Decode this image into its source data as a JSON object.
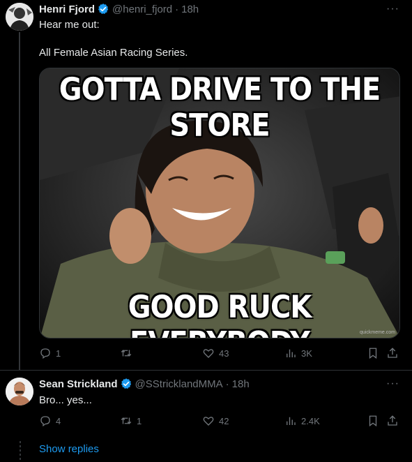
{
  "tweet1": {
    "name": "Henri Fjord",
    "handle": "@henri_fjord",
    "time": "18h",
    "more": "···",
    "text_line1": "Hear me out:",
    "text_line2": "All Female Asian Racing Series.",
    "media": {
      "top_text": "GOTTA DRIVE TO THE STORE",
      "bottom_text": "GOOD RUCK EVERYBODY",
      "watermark": "quickmeme.com"
    },
    "actions": {
      "replies": "1",
      "reposts": "",
      "likes": "43",
      "views": "3K"
    }
  },
  "tweet2": {
    "name": "Sean Strickland",
    "handle": "@SStricklandMMA",
    "time": "18h",
    "more": "···",
    "text": "Bro... yes...",
    "actions": {
      "replies": "4",
      "reposts": "1",
      "likes": "42",
      "views": "2.4K"
    }
  },
  "show_replies": "Show replies",
  "separator": "·",
  "colors": {
    "background": "#000000",
    "text": "#e7e9ea",
    "secondary": "#71767b",
    "accent": "#1d9bf0",
    "border": "#2f3336"
  }
}
